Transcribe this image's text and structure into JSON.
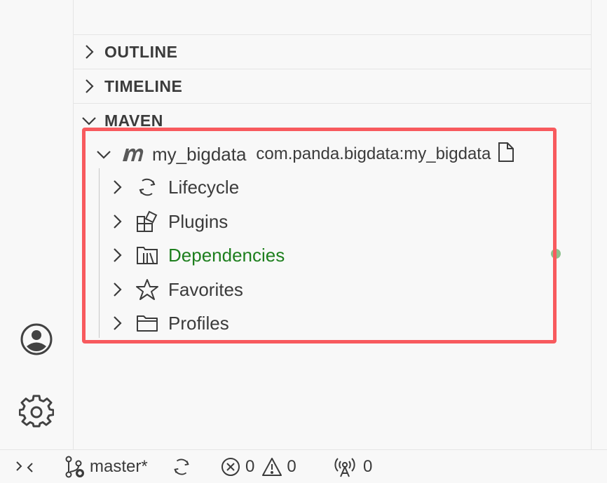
{
  "sections": {
    "outline": {
      "label": "OUTLINE"
    },
    "timeline": {
      "label": "TIMELINE"
    },
    "maven": {
      "label": "MAVEN"
    }
  },
  "project": {
    "name": "my_bigdata",
    "artifact": "com.panda.bigdata:my_bigdata",
    "icon": "maven-icon"
  },
  "tree": [
    {
      "label": "Lifecycle",
      "icon": "sync-icon"
    },
    {
      "label": "Plugins",
      "icon": "extensions-icon"
    },
    {
      "label": "Dependencies",
      "icon": "library-icon",
      "color": "#1e7f1e",
      "dot_color": "#8dc08d"
    },
    {
      "label": "Favorites",
      "icon": "star-icon"
    },
    {
      "label": "Profiles",
      "icon": "folder-icon"
    }
  ],
  "status_bar": {
    "branch": "master*",
    "errors": "0",
    "warnings": "0",
    "ports": "0"
  },
  "colors": {
    "highlight": "#f85a5e",
    "dependencies_text": "#1e7f1e"
  }
}
